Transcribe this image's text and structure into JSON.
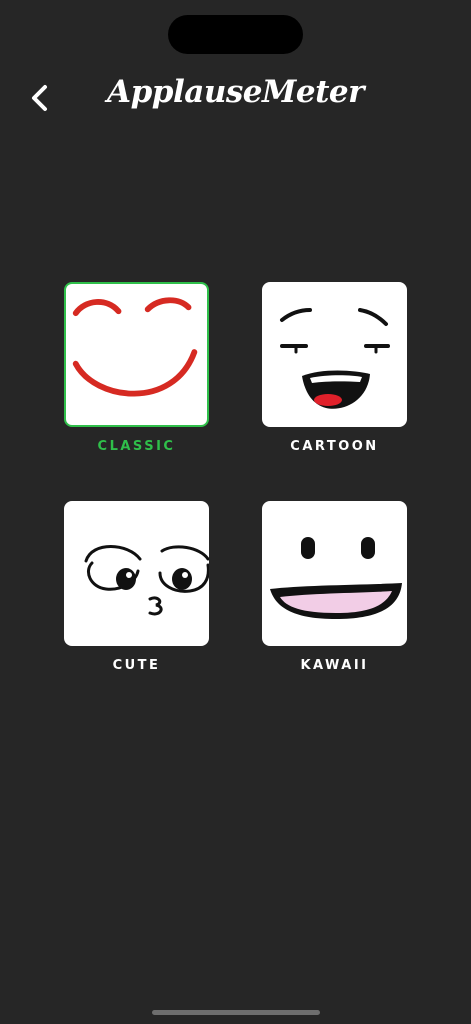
{
  "app": {
    "title": "ApplauseMeter"
  },
  "nav": {
    "back_icon": "chevron-left-icon"
  },
  "styles": [
    {
      "label": "CLASSIC",
      "selected": true
    },
    {
      "label": "CARTOON",
      "selected": false
    },
    {
      "label": "CUTE",
      "selected": false
    },
    {
      "label": "KAWAII",
      "selected": false
    }
  ],
  "colors": {
    "background": "#262626",
    "selected": "#2fbf4a",
    "classic_stroke": "#d62a22"
  }
}
